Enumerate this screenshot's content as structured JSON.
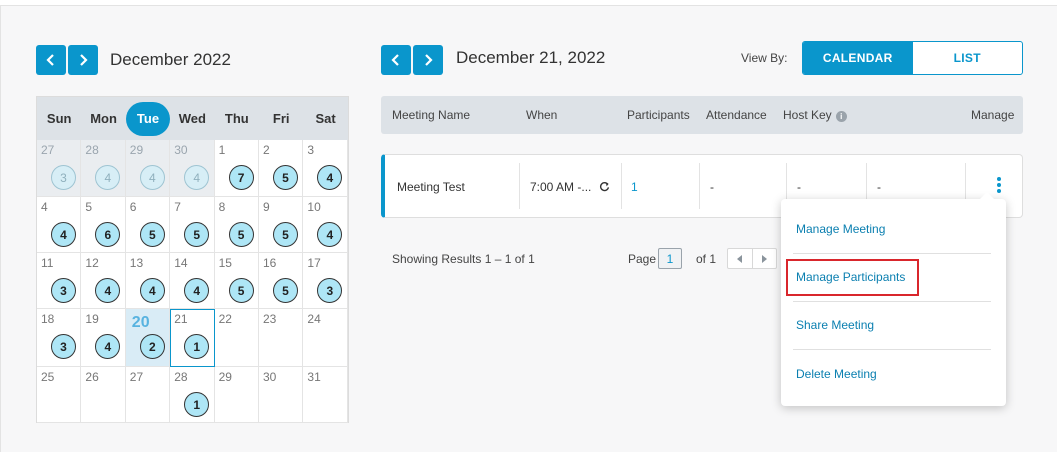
{
  "left_nav": {
    "month_title": "December 2022"
  },
  "calendar": {
    "weekdays": [
      "Sun",
      "Mon",
      "Tue",
      "Wed",
      "Thu",
      "Fri",
      "Sat"
    ],
    "today_weekday_index": 2,
    "weeks": [
      [
        {
          "day": "27",
          "count": "3",
          "other": true
        },
        {
          "day": "28",
          "count": "4",
          "other": true
        },
        {
          "day": "29",
          "count": "4",
          "other": true
        },
        {
          "day": "30",
          "count": "4",
          "other": true
        },
        {
          "day": "1",
          "count": "7"
        },
        {
          "day": "2",
          "count": "5"
        },
        {
          "day": "3",
          "count": "4"
        }
      ],
      [
        {
          "day": "4",
          "count": "4"
        },
        {
          "day": "5",
          "count": "6"
        },
        {
          "day": "6",
          "count": "5"
        },
        {
          "day": "7",
          "count": "5"
        },
        {
          "day": "8",
          "count": "5"
        },
        {
          "day": "9",
          "count": "5"
        },
        {
          "day": "10",
          "count": "4"
        }
      ],
      [
        {
          "day": "11",
          "count": "3"
        },
        {
          "day": "12",
          "count": "4"
        },
        {
          "day": "13",
          "count": "4"
        },
        {
          "day": "14",
          "count": "4"
        },
        {
          "day": "15",
          "count": "5"
        },
        {
          "day": "16",
          "count": "5"
        },
        {
          "day": "17",
          "count": "3"
        }
      ],
      [
        {
          "day": "18",
          "count": "3"
        },
        {
          "day": "19",
          "count": "4"
        },
        {
          "day": "20",
          "count": "2",
          "today": true
        },
        {
          "day": "21",
          "count": "1",
          "selected": true
        },
        {
          "day": "22"
        },
        {
          "day": "23"
        },
        {
          "day": "24"
        }
      ],
      [
        {
          "day": "25"
        },
        {
          "day": "26"
        },
        {
          "day": "27"
        },
        {
          "day": "28",
          "count": "1"
        },
        {
          "day": "29"
        },
        {
          "day": "30"
        },
        {
          "day": "31"
        }
      ]
    ]
  },
  "day_nav": {
    "date_title": "December 21, 2022"
  },
  "view_by": {
    "label": "View By:",
    "calendar": "CALENDAR",
    "list": "LIST",
    "active": "calendar"
  },
  "table": {
    "headers": {
      "name": "Meeting Name",
      "when": "When",
      "participants": "Participants",
      "attendance": "Attendance",
      "host_key": "Host Key",
      "manage": "Manage"
    },
    "rows": [
      {
        "name": "Meeting Test",
        "when": "7:00 AM -...",
        "participants": "1",
        "attendance": "-",
        "host_key": "-",
        "extra": "-"
      }
    ]
  },
  "pagination": {
    "results": "Showing Results 1 – 1 of 1",
    "page_label": "Page",
    "page": "1",
    "of": "of 1"
  },
  "menu": {
    "items": [
      "Manage Meeting",
      "Manage Participants",
      "Share Meeting",
      "Delete Meeting"
    ],
    "highlighted_index": 1
  },
  "colors": {
    "accent": "#0a96cc",
    "highlight_box": "#d9262c",
    "badge": "#aee6f6"
  }
}
